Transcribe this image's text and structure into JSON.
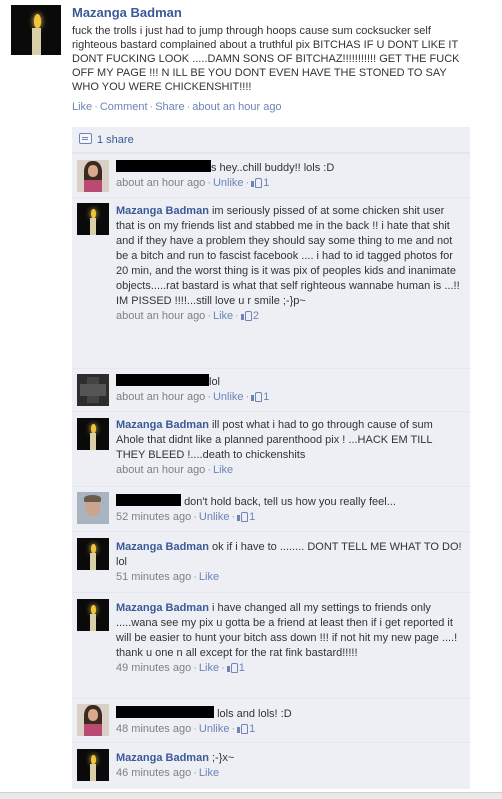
{
  "post": {
    "author": "Mazanga Badman",
    "text": "fuck the trolls i just had to jump through hoops cause sum cocksucker self righteous bastard complained about a truthful pix BITCHAS IF U DONT LIKE IT DONT FUCKING LOOK .....DAMN SONS OF BITCHAZ!!!!!!!!!!! GET THE FUCK OFF MY PAGE !!! N ILL BE YOU DONT EVEN HAVE THE STONED TO SAY WHO YOU WERE CHICKENSHIT!!!!",
    "actions": {
      "like": "Like",
      "comment": "Comment",
      "share": "Share",
      "time": "about an hour ago"
    },
    "avatar_icon": "candle-avatar"
  },
  "shares": {
    "label": "1 share",
    "icon": "share-icon"
  },
  "comments": [
    {
      "author": "",
      "text": "s hey..chill buddy!! lols :D",
      "time": "about an hour ago",
      "action": "Unlike",
      "likes": "1",
      "avatar": "girl-avatar"
    },
    {
      "author": "Mazanga Badman",
      "text": "im seriously pissed of at some chicken shit user that is on my friends list and stabbed me in the back !! i hate that shit and if they have a problem they should say some thing to me and not be a bitch and run to fascist facebook .... i had to id tagged photos for 20 min, and the worst thing is it was pix of peoples kids and inanimate objects.....rat bastard is what that self righteous wannabe human is ...!! IM PISSED !!!!...still love u r smile ;-}p~",
      "time": "about an hour ago",
      "action": "Like",
      "likes": "2",
      "avatar": "candle-avatar"
    },
    {
      "author": "",
      "text": "lol",
      "time": "about an hour ago",
      "action": "Unlike",
      "likes": "1",
      "avatar": "dark-avatar"
    },
    {
      "author": "Mazanga Badman",
      "text": "ill post what i had to go through cause of sum Ahole that didnt like a planned parenthood pix ! ...HACK EM TILL THEY BLEED !....death to chickenshits",
      "time": "about an hour ago",
      "action": "Like",
      "likes": "",
      "avatar": "candle-avatar"
    },
    {
      "author": "",
      "text": "don't hold back, tell us how you really feel...",
      "time": "52 minutes ago",
      "action": "Unlike",
      "likes": "1",
      "avatar": "guy-avatar"
    },
    {
      "author": "Mazanga Badman",
      "text": "ok if i have to ........ DONT TELL ME WHAT TO DO! lol",
      "time": "51 minutes ago",
      "action": "Like",
      "likes": "",
      "avatar": "candle-avatar"
    },
    {
      "author": "Mazanga Badman",
      "text": "i have changed all my settings to friends only .....wana see my pix u gotta be a friend at least then if i get reported it will be easier to hunt your bitch ass down !!! if not hit my new page ....! thank u one n all except for the rat fink bastard!!!!!",
      "time": "49 minutes ago",
      "action": "Like",
      "likes": "1",
      "avatar": "candle-avatar"
    },
    {
      "author": "",
      "text": "lols and lols! :D",
      "time": "48 minutes ago",
      "action": "Unlike",
      "likes": "1",
      "avatar": "girl-avatar"
    },
    {
      "author": "Mazanga Badman",
      "text": ";-}x~",
      "time": "46 minutes ago",
      "action": "Like",
      "likes": "",
      "avatar": "candle-avatar"
    }
  ],
  "colors": {
    "link": "#3b5998",
    "ufi_bg": "#edeff4",
    "meta": "#808080"
  }
}
